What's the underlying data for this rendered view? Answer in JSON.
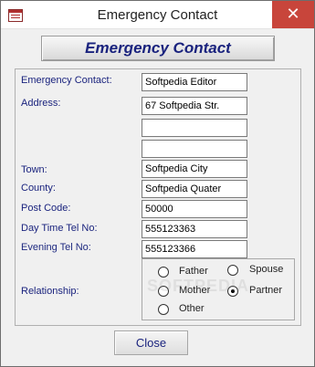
{
  "window": {
    "title": "Emergency Contact",
    "close_glyph": "✕"
  },
  "form": {
    "header_label": "Emergency Contact",
    "fields": {
      "emergency_contact": {
        "label": "Emergency Contact:",
        "value": "Softpedia Editor"
      },
      "address": {
        "label": "Address:",
        "lines": [
          "67 Softpedia Str.",
          "",
          ""
        ]
      },
      "town": {
        "label": "Town:",
        "value": "Softpedia City"
      },
      "county": {
        "label": "County:",
        "value": "Softpedia Quater"
      },
      "post_code": {
        "label": "Post Code:",
        "value": "50000"
      },
      "day_tel": {
        "label": "Day Time Tel No:",
        "value": "555123363"
      },
      "evening_tel": {
        "label": "Evening Tel No:",
        "value": "555123366"
      }
    },
    "relationship": {
      "label": "Relationship:",
      "options": [
        {
          "label": "Father",
          "selected": false
        },
        {
          "label": "Spouse",
          "selected": false
        },
        {
          "label": "Mother",
          "selected": false
        },
        {
          "label": "Partner",
          "selected": true
        },
        {
          "label": "Other",
          "selected": false
        }
      ]
    },
    "watermark": "SOFTPEDIA",
    "close_button": "Close"
  },
  "colors": {
    "label_text": "#1a237e",
    "close_caption": "#c8453b"
  }
}
